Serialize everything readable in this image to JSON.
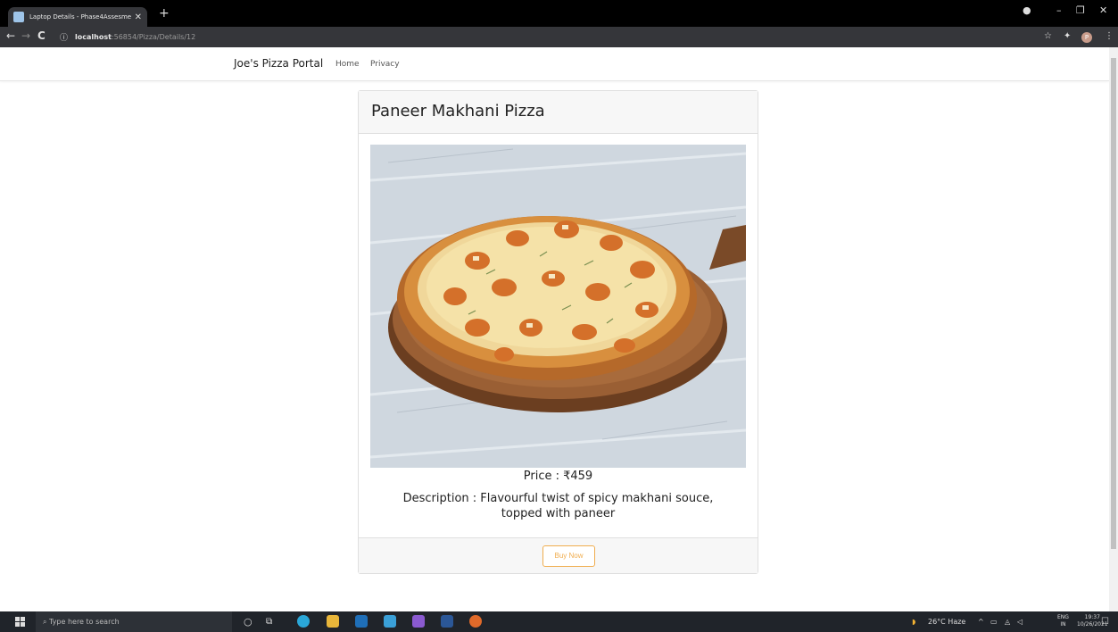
{
  "browser": {
    "tab_title": "Laptop Details - Phase4Assesme",
    "new_tab": "+",
    "url_host": "localhost",
    "url_rest": ":56854/Pizza/Details/12",
    "profile_initial": "P"
  },
  "navbar": {
    "brand": "Joe's Pizza Portal",
    "links": [
      "Home",
      "Privacy"
    ]
  },
  "card": {
    "title": "Paneer Makhani Pizza",
    "price": "Price : ₹459",
    "description": "Description : Flavourful twist of spicy makhani souce, topped with paneer",
    "buy_label": "Buy Now"
  },
  "taskbar": {
    "search_placeholder": "Type here to search",
    "weather": "26°C  Haze",
    "lang_top": "ENG",
    "lang_bottom": "IN",
    "time": "19:37",
    "date": "10/26/2021"
  },
  "colors": {
    "accent_warning": "#f0ad4e",
    "titlebar": "#000000",
    "toolbar": "#35363a",
    "taskbar": "#20242a"
  }
}
